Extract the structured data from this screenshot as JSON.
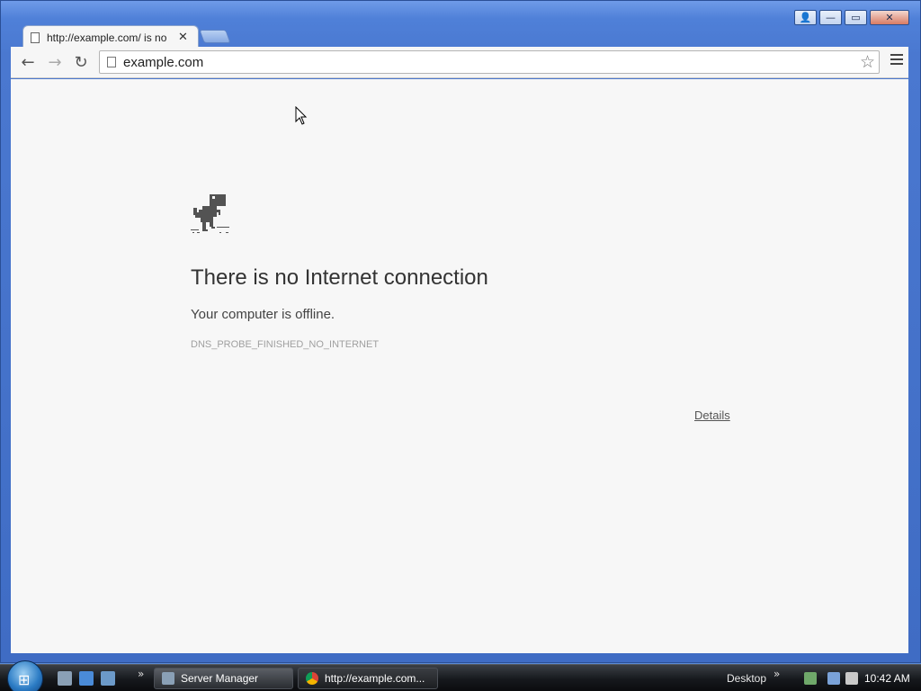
{
  "window": {
    "controls": [
      "person-icon",
      "minimize-icon",
      "maximize-icon",
      "close-icon"
    ],
    "control_glyphs": {
      "user": "👤",
      "minimize": "—",
      "maximize": "▭",
      "close": "✕"
    }
  },
  "tab": {
    "title": "http://example.com/ is no",
    "close_glyph": "✕"
  },
  "toolbar": {
    "back_glyph": "←",
    "forward_glyph": "→",
    "reload_glyph": "↻",
    "url": "example.com",
    "star_glyph": "☆"
  },
  "page": {
    "headline": "There is no Internet connection",
    "subline": "Your computer is offline.",
    "error_code": "DNS_PROBE_FINISHED_NO_INTERNET",
    "details_label": "Details"
  },
  "taskbar": {
    "start_glyph": "⊞",
    "quicklaunch_more": "»",
    "buttons": [
      {
        "label": "Server Manager"
      },
      {
        "label": "http://example.com..."
      }
    ],
    "desktop_label": "Desktop",
    "desktop_more": "»",
    "clock": "10:42 AM"
  },
  "colors": {
    "frame": "#4a78d0",
    "content_bg": "#f7f7f7",
    "text": "#333333",
    "muted": "#a0a0a0"
  }
}
